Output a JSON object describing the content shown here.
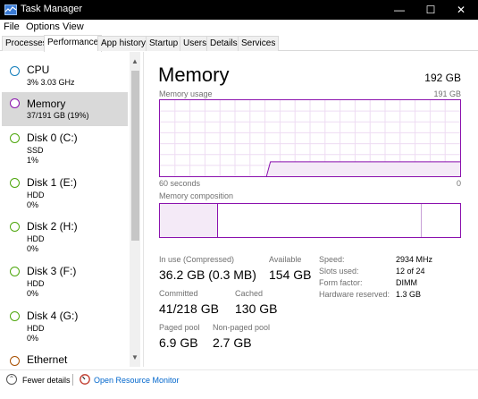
{
  "window": {
    "title": "Task Manager",
    "controls": {
      "minimize": "—",
      "maximize": "☐",
      "close": "✕"
    }
  },
  "menu": [
    "File",
    "Options",
    "View"
  ],
  "tabs": [
    "Processes",
    "Performance",
    "App history",
    "Startup",
    "Users",
    "Details",
    "Services"
  ],
  "active_tab": "Performance",
  "sidebar": {
    "items": [
      {
        "name": "CPU",
        "sub1": "3% 3.03 GHz",
        "sub2": "",
        "sub3": "",
        "color": "#117dbb"
      },
      {
        "name": "Memory",
        "sub1": "37/191 GB (19%)",
        "sub2": "",
        "sub3": "",
        "color": "#8b12ae"
      },
      {
        "name": "Disk 0 (C:)",
        "sub1": "SSD",
        "sub2": "1%",
        "sub3": "",
        "color": "#4da60c"
      },
      {
        "name": "Disk 1 (E:)",
        "sub1": "HDD",
        "sub2": "0%",
        "sub3": "",
        "color": "#4da60c"
      },
      {
        "name": "Disk 2 (H:)",
        "sub1": "HDD",
        "sub2": "0%",
        "sub3": "",
        "color": "#4da60c"
      },
      {
        "name": "Disk 3 (F:)",
        "sub1": "HDD",
        "sub2": "0%",
        "sub3": "",
        "color": "#4da60c"
      },
      {
        "name": "Disk 4 (G:)",
        "sub1": "HDD",
        "sub2": "0%",
        "sub3": "",
        "color": "#4da60c"
      },
      {
        "name": "Ethernet",
        "sub1": "",
        "sub2": "",
        "sub3": "",
        "color": "#a74f01"
      }
    ],
    "selected": "Memory"
  },
  "detail": {
    "title": "Memory",
    "total": "192 GB",
    "usage_label": "Memory usage",
    "usage_max": "191 GB",
    "x_left": "60 seconds",
    "x_right": "0",
    "composition_label": "Memory composition",
    "usage_level": 0.19,
    "composition": {
      "in_use_fraction": 0.19,
      "modified_fraction": 0.002,
      "standby_fraction": 0.68
    },
    "stats": {
      "in_use_label": "In use (Compressed)",
      "in_use_value": "36.2 GB (0.3 MB)",
      "available_label": "Available",
      "available_value": "154 GB",
      "committed_label": "Committed",
      "committed_value": "41/218 GB",
      "cached_label": "Cached",
      "cached_value": "130 GB",
      "paged_label": "Paged pool",
      "paged_value": "6.9 GB",
      "nonpaged_label": "Non-paged pool",
      "nonpaged_value": "2.7 GB"
    },
    "details": [
      {
        "key": "Speed:",
        "value": "2934 MHz"
      },
      {
        "key": "Slots used:",
        "value": "12 of 24"
      },
      {
        "key": "Form factor:",
        "value": "DIMM"
      },
      {
        "key": "Hardware reserved:",
        "value": "1.3 GB"
      }
    ]
  },
  "footer": {
    "fewer_details": "Fewer details",
    "open_resource_monitor": "Open Resource Monitor"
  },
  "colors": {
    "memory_accent": "#8b12ae",
    "memory_fill": "#f4eaf7",
    "link": "#0066cc"
  }
}
